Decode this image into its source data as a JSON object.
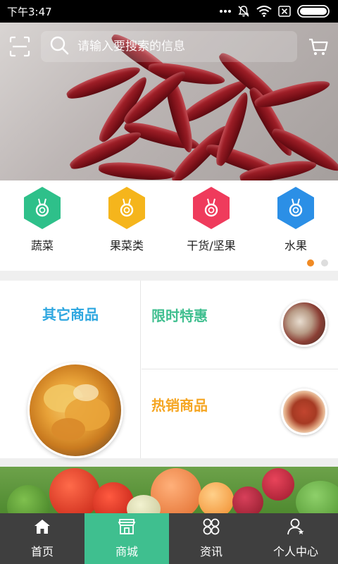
{
  "status_bar": {
    "time": "下午3:47",
    "icons": [
      "more-dots-icon",
      "mute-bell-icon",
      "wifi-icon",
      "sim-x-icon",
      "battery-icon"
    ]
  },
  "top_bar": {
    "scan_icon": "scan-icon",
    "search": {
      "placeholder": "请输入要搜索的信息",
      "icon": "search-icon"
    },
    "cart_icon": "cart-icon"
  },
  "categories": {
    "items": [
      {
        "label": "蔬菜",
        "color": "#2ec08a",
        "icon": "medal-icon"
      },
      {
        "label": "果菜类",
        "color": "#f5b51c",
        "icon": "medal-icon"
      },
      {
        "label": "干货/坚果",
        "color": "#ef3b5c",
        "icon": "medal-icon"
      },
      {
        "label": "水果",
        "color": "#2b8fe6",
        "icon": "medal-icon"
      }
    ],
    "page_dots": 2,
    "active_dot": 1,
    "dot_active_color": "#f08a24"
  },
  "promo": {
    "other_goods": {
      "title": "其它商品",
      "color": "#2ea7e0"
    },
    "limited_offer": {
      "title": "限时特惠",
      "color": "#3fbf8f"
    },
    "hot_goods": {
      "title": "热销商品",
      "color": "#f5a623"
    }
  },
  "bottom_nav": {
    "items": [
      {
        "label": "首页",
        "icon": "home-icon"
      },
      {
        "label": "商城",
        "icon": "store-icon"
      },
      {
        "label": "资讯",
        "icon": "news-icon"
      },
      {
        "label": "个人中心",
        "icon": "user-icon"
      }
    ],
    "active_index": 1,
    "active_color": "#3fbf8f"
  }
}
